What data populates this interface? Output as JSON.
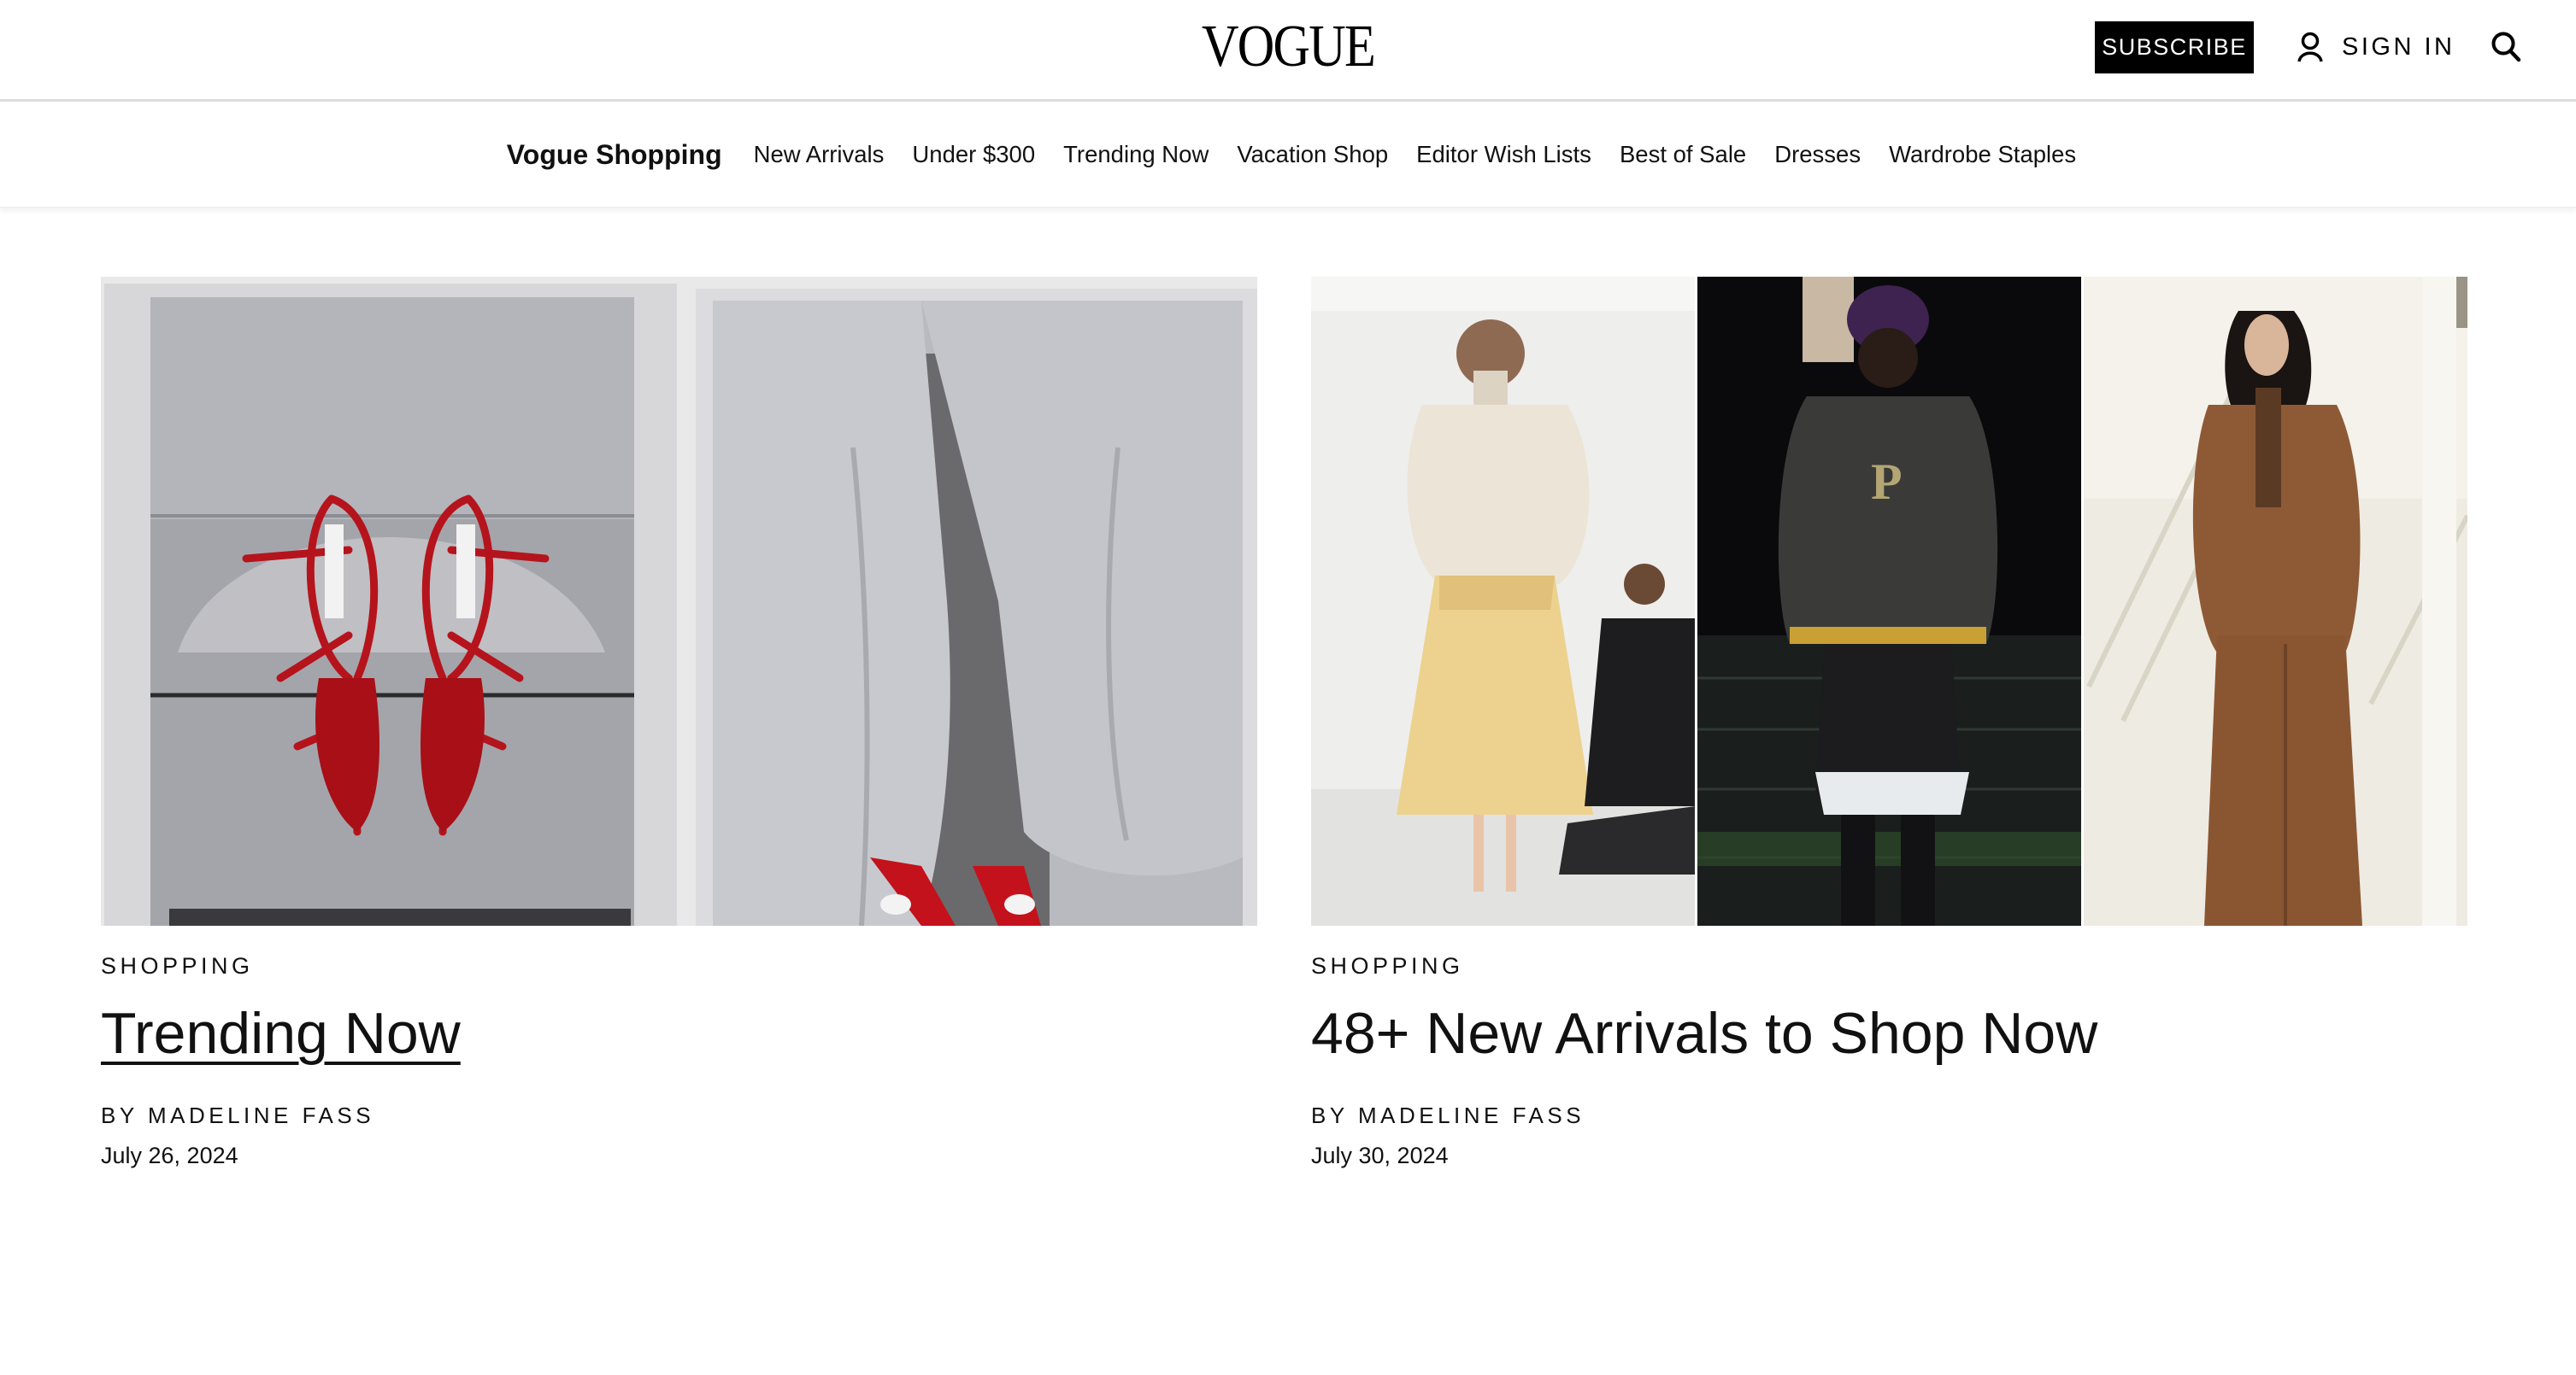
{
  "header": {
    "logo": "VOGUE",
    "subscribe_label": "SUBSCRIBE",
    "sign_in_label": "SIGN IN"
  },
  "nav": {
    "brand": "Vogue Shopping",
    "links": [
      "New Arrivals",
      "Under $300",
      "Trending Now",
      "Vacation Shop",
      "Editor Wish Lists",
      "Best of Sale",
      "Dresses",
      "Wardrobe Staples"
    ]
  },
  "articles": [
    {
      "kicker": "SHOPPING",
      "title": "Trending Now",
      "byline_prefix": "BY",
      "author": "MADELINE FASS",
      "date": "July 26, 2024"
    },
    {
      "kicker": "SHOPPING",
      "title": "48+ New Arrivals to Shop Now",
      "byline_prefix": "BY",
      "author": "MADELINE FASS",
      "date": "July 30, 2024"
    }
  ],
  "colors": {
    "text": "#111111",
    "subscribe_bg": "#000000",
    "subscribe_text": "#ffffff",
    "divider": "#dddddd"
  },
  "icons": {
    "account": "user-icon",
    "search": "search-icon"
  }
}
